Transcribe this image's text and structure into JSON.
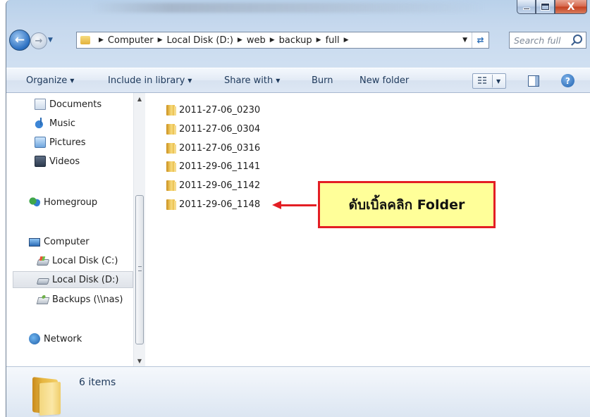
{
  "window": {
    "controls": {
      "close_label": "X"
    }
  },
  "navigation": {
    "back_icon": "back-arrow-icon",
    "forward_icon": "forward-arrow-icon"
  },
  "address_bar": {
    "breadcrumbs": [
      "Computer",
      "Local Disk (D:)",
      "web",
      "backup",
      "full"
    ]
  },
  "search": {
    "placeholder": "Search full"
  },
  "toolbar": {
    "organize": "Organize",
    "include_in_library": "Include in library",
    "share_with": "Share with",
    "burn": "Burn",
    "new_folder": "New folder",
    "help": "?"
  },
  "sidebar": {
    "items": [
      {
        "label": "Documents",
        "icon": "documents-icon"
      },
      {
        "label": "Music",
        "icon": "music-icon"
      },
      {
        "label": "Pictures",
        "icon": "pictures-icon"
      },
      {
        "label": "Videos",
        "icon": "videos-icon"
      },
      {
        "label": "Homegroup",
        "icon": "homegroup-icon"
      },
      {
        "label": "Computer",
        "icon": "computer-icon"
      },
      {
        "label": "Local Disk (C:)",
        "icon": "system-disk-icon"
      },
      {
        "label": "Local Disk (D:)",
        "icon": "disk-icon",
        "selected": true
      },
      {
        "label": "Backups (\\\\nas)",
        "icon": "network-drive-icon"
      },
      {
        "label": "Network",
        "icon": "network-icon"
      }
    ]
  },
  "files": [
    {
      "name": "2011-27-06_0230"
    },
    {
      "name": "2011-27-06_0304"
    },
    {
      "name": "2011-27-06_0316"
    },
    {
      "name": "2011-29-06_1141"
    },
    {
      "name": "2011-29-06_1142"
    },
    {
      "name": "2011-29-06_1148"
    }
  ],
  "annotation": {
    "callout_text": "ดับเบิ้ลคลิก Folder",
    "border_color": "#e31e24",
    "fill_color": "#ffff99"
  },
  "details_pane": {
    "item_count": "6 items"
  }
}
